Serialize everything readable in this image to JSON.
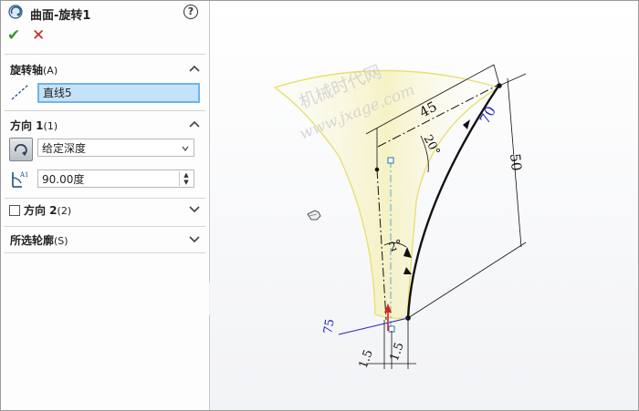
{
  "panel": {
    "title": "曲面-旋转1",
    "help_symbol": "?",
    "ok_symbol": "✔",
    "cancel_symbol": "✕",
    "axis_section": {
      "label": "旋转轴",
      "key": "(A)",
      "value": "直线5"
    },
    "direction1": {
      "label": "方向 1",
      "key": "(1)",
      "end_condition": "给定深度",
      "angle": "90.00度"
    },
    "direction2": {
      "label": "方向 2",
      "key": "(2)",
      "checked": false
    },
    "contours": {
      "label": "所选轮廓",
      "key": "(S)"
    }
  },
  "viewport": {
    "watermark_line1": "机械时代网",
    "watermark_line2": "www.jxage.com",
    "dimensions": {
      "d45": "45",
      "d70": "70",
      "d50": "50",
      "d75": "75",
      "d20deg": "20°",
      "d2deg": "2°",
      "d1_5": "1.5",
      "d1_5b": "1.5"
    }
  },
  "colors": {
    "ok": "#2f9a2f",
    "cancel": "#d22020",
    "selection": "#6fb3ec",
    "surface_edge": "#e8e070",
    "dimension_blue": "#2020c0"
  }
}
